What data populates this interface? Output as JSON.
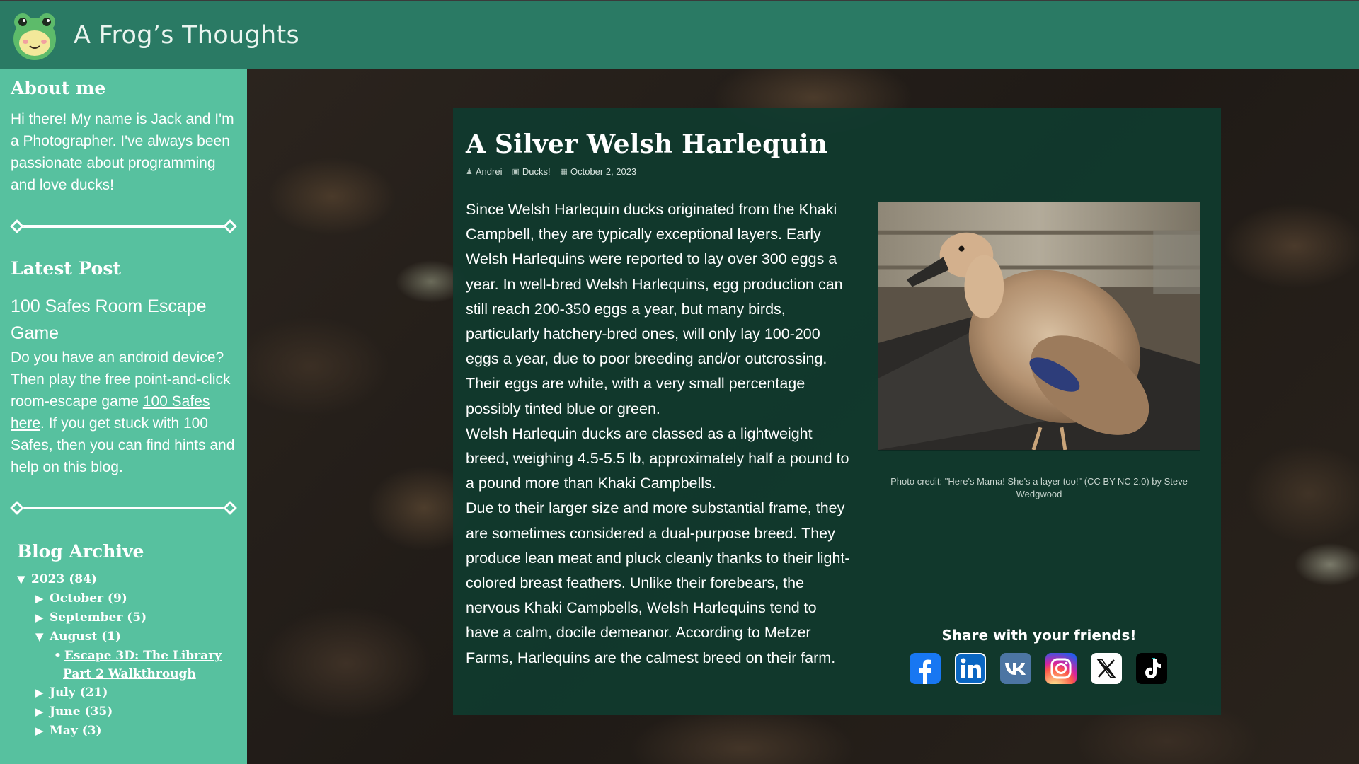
{
  "header": {
    "site_title": "A Frog’s Thoughts",
    "logo_icon": "frog-logo-icon"
  },
  "sidebar": {
    "about": {
      "heading": "About me",
      "text": "Hi there! My name is Jack and I'm a Photographer. I've always been passionate about programming and love ducks!"
    },
    "latest": {
      "heading": "Latest Post",
      "post_title": "100 Safes Room Escape Game",
      "text_before": "Do you have an android device? Then play the free point-and-click room-escape game ",
      "link_text": "100 Safes here",
      "text_after": ". If you get stuck with 100 Safes, then you can find hints and help on this blog."
    },
    "archive": {
      "heading": "Blog Archive",
      "year": "2023 (84)",
      "months": [
        {
          "label": "October (9)",
          "expanded": false
        },
        {
          "label": "September (5)",
          "expanded": false
        },
        {
          "label": "August (1)",
          "expanded": true
        },
        {
          "label": "July (21)",
          "expanded": false
        },
        {
          "label": "June (35)",
          "expanded": false
        },
        {
          "label": "May (3)",
          "expanded": false
        }
      ],
      "august_post_line1": "Escape 3D: The Library",
      "august_post_line2": "Part 2 Walkthrough"
    }
  },
  "article": {
    "title": "A Silver Welsh Harlequin",
    "author": "Andrei",
    "category": "Ducks!",
    "date": "October 2, 2023",
    "paragraph1": "Since Welsh Harlequin ducks originated from the Khaki Campbell, they are typically exceptional layers. Early Welsh Harlequins were reported to lay over 300 eggs a year. In well-bred Welsh Harlequins, egg production can still reach 200-350 eggs a year, but many birds, particularly hatchery-bred ones, will only lay 100-200 eggs a year, due to poor breeding and/or outcrossing. Their eggs are white, with a very small percentage possibly tinted blue or green.",
    "paragraph2": "Welsh Harlequin ducks are classed as a lightweight breed, weighing 4.5-5.5 lb, approximately half a pound to a pound more than Khaki Campbells.",
    "paragraph3": "Due to their larger size and more substantial frame, they are sometimes considered a dual-purpose breed. They produce lean meat and pluck cleanly thanks to their light-colored breast feathers. Unlike their forebears, the nervous Khaki Campbells, Welsh Harlequins tend to have a calm, docile demeanor. According to Metzer Farms, Harlequins are the calmest breed on their farm.",
    "photo_caption": "Photo credit: \"Here's Mama! She's a layer too!\" (CC BY-NC 2.0) by Steve Wedgwood",
    "share_heading": "Share with your friends!",
    "share_icons": [
      "facebook-icon",
      "linkedin-icon",
      "vk-icon",
      "instagram-icon",
      "x-icon",
      "tiktok-icon"
    ]
  },
  "colors": {
    "header": "#2a7a64",
    "sidebar": "#57c19f",
    "article_panel": "#103a2e",
    "facebook": "#1877f2",
    "linkedin": "#0a66c2",
    "vk": "#4c75a3",
    "instagram": "#d6249f",
    "x": "#000000",
    "tiktok": "#000000"
  }
}
